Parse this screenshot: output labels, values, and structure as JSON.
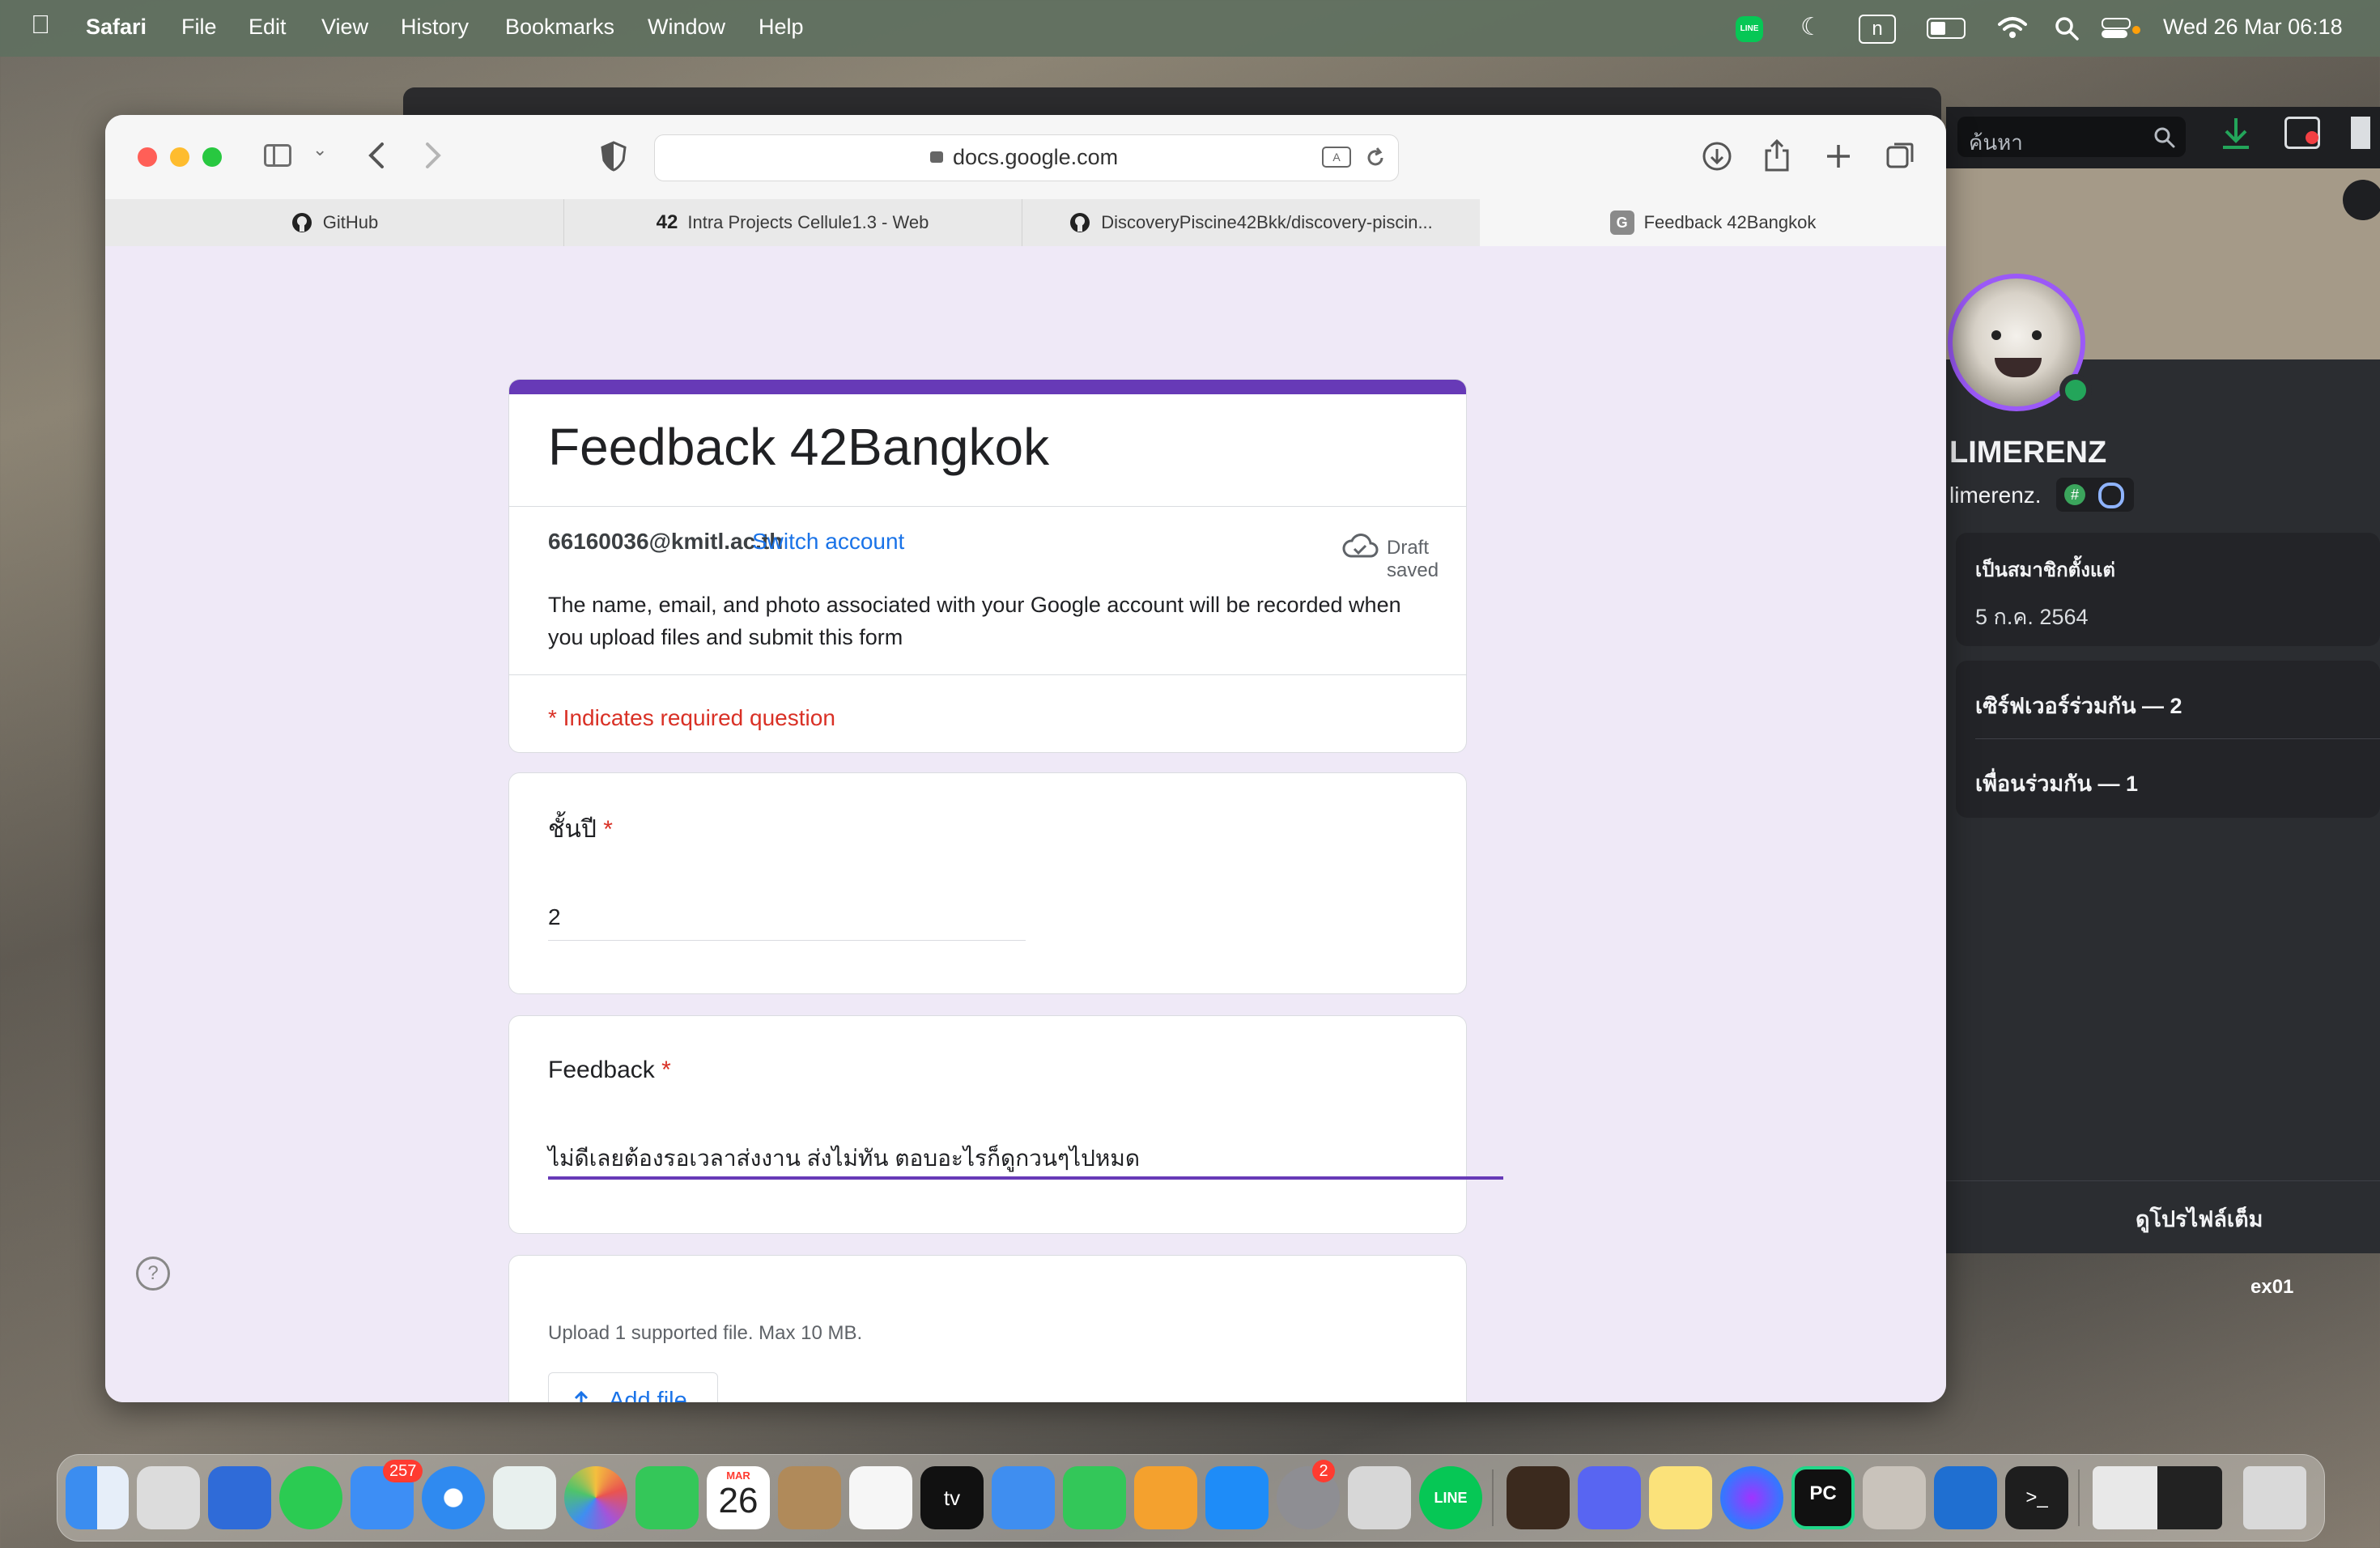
{
  "menubar": {
    "app": "Safari",
    "items": [
      "File",
      "Edit",
      "View",
      "History",
      "Bookmarks",
      "Window",
      "Help"
    ],
    "status_box": "n",
    "datetime": "Wed 26 Mar  06:18"
  },
  "toolbar": {
    "url": "docs.google.com"
  },
  "tabs": [
    {
      "label": "GitHub"
    },
    {
      "label": "Intra Projects Cellule1.3 - Web"
    },
    {
      "label": "DiscoveryPiscine42Bkk/discovery-piscin..."
    },
    {
      "label": "Feedback 42Bangkok",
      "favicon": "G"
    }
  ],
  "form": {
    "title": "Feedback 42Bangkok",
    "email": "66160036@kmitl.ac.th",
    "switch_account": "Switch account",
    "draft_status": "Draft saved",
    "notice": "The name, email, and photo associated with your Google account will be recorded when you upload files and submit this form",
    "required_note": "* Indicates required question",
    "q1": {
      "label": "ชั้นปี",
      "asterisk": "*",
      "value": "2"
    },
    "q2": {
      "label": "Feedback",
      "asterisk": "*",
      "value": "ไม่ดีเลยต้องรอเวลาส่งงาน ส่งไม่ทัน ตอบอะไรก็ดูกวนๆไปหมด"
    },
    "upload": {
      "hint": "Upload 1 supported file. Max 10 MB.",
      "button": "Add file"
    },
    "accent": "#673ab7"
  },
  "discord": {
    "search_placeholder": "ค้นหา",
    "display_name": "LIMERENZ",
    "username": "limerenz.",
    "member_since_label": "เป็นสมาชิกตั้งแต่",
    "member_since_date": "5 ก.ค. 2564",
    "mutual_servers": "เซิร์ฟเวอร์ร่วมกัน — 2",
    "mutual_friends": "เพื่อนร่วมกัน — 1",
    "view_profile": "ดูโปรไฟล์เต็ม",
    "status_color": "#23a55a"
  },
  "desktop": {
    "label": "ex01"
  },
  "dock": {
    "calendar_month": "MAR",
    "calendar_day": "26",
    "mail_badge": "257",
    "settings_badge": "2"
  }
}
